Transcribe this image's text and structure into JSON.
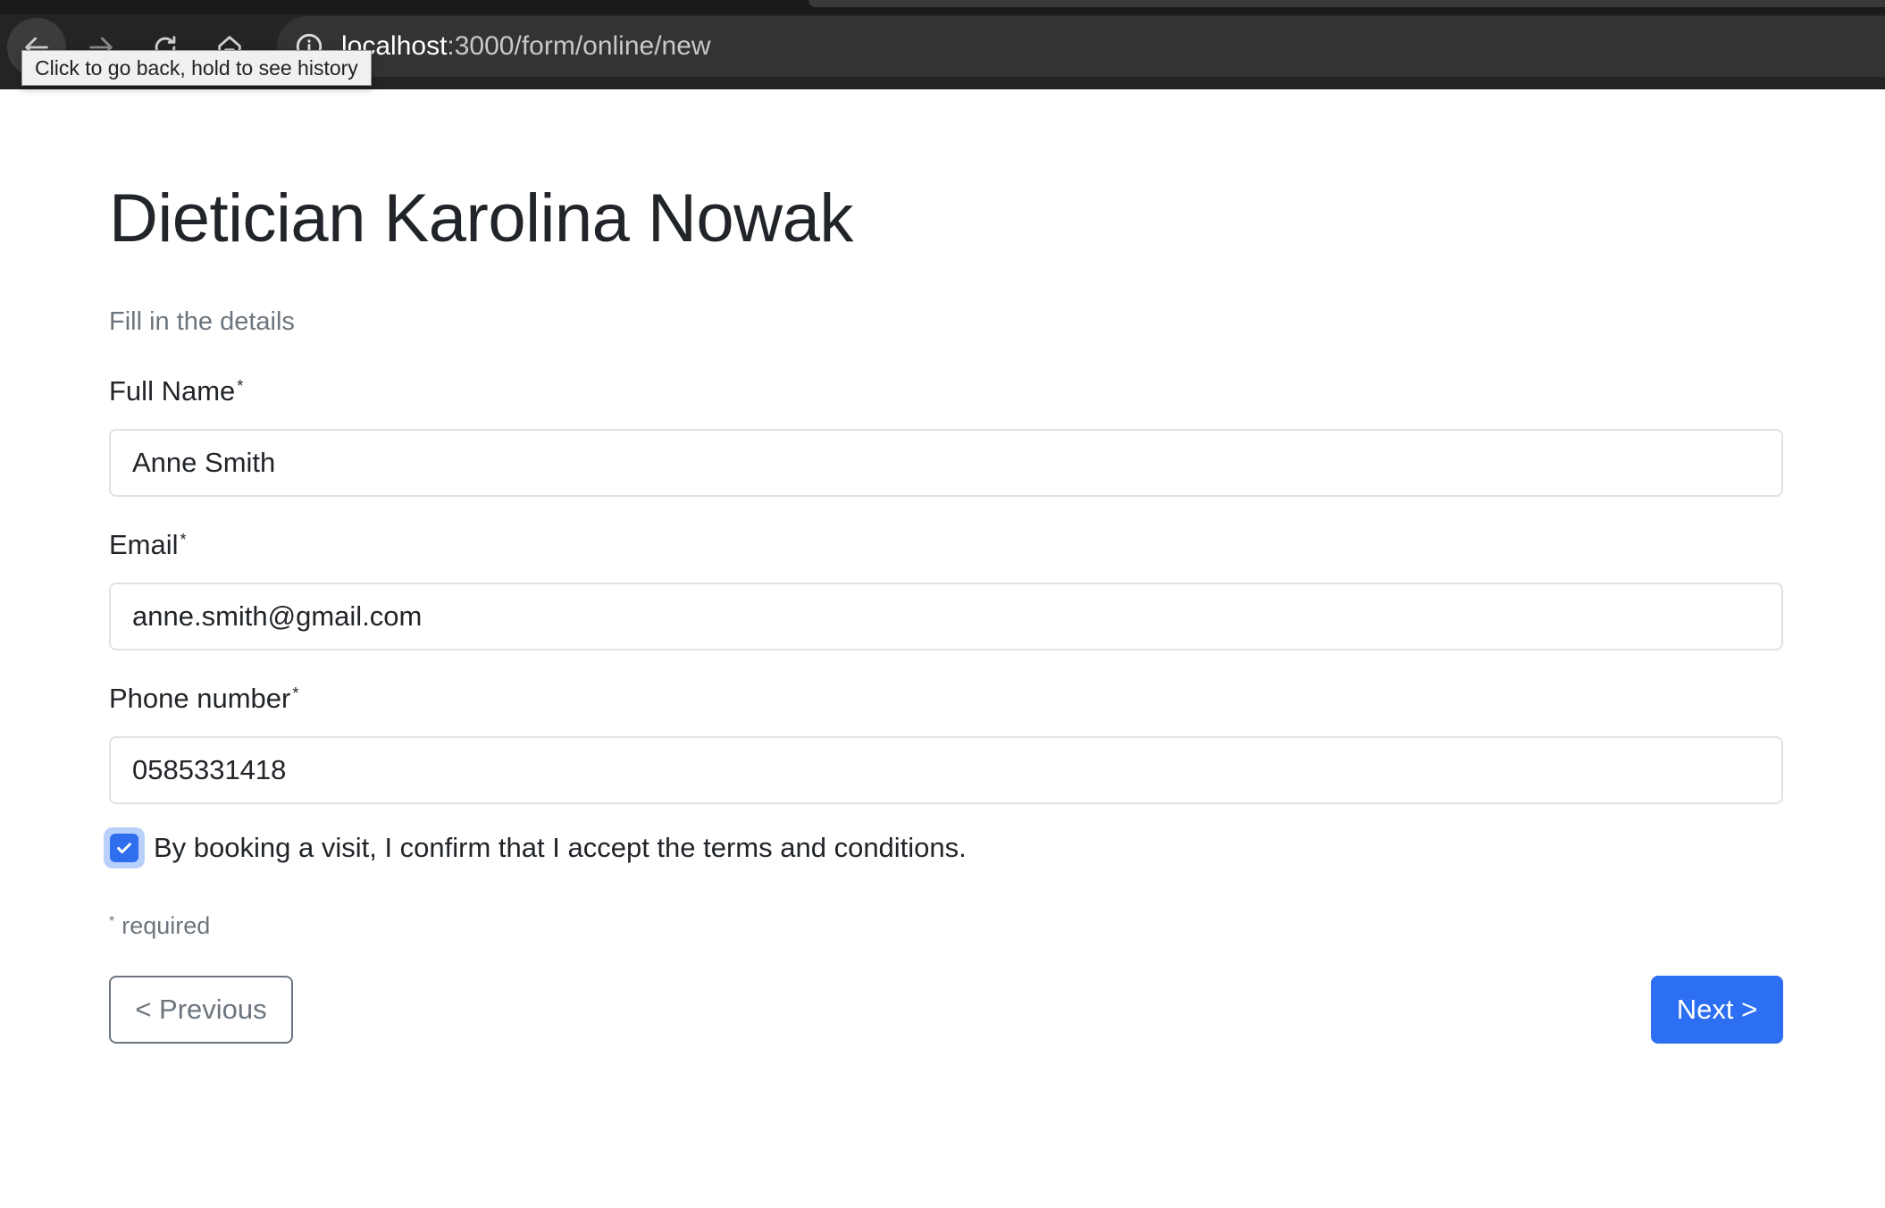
{
  "browser": {
    "url_host": "localhost",
    "url_path": ":3000/form/online/new",
    "back_tooltip": "Click to go back, hold to see history",
    "icons": [
      "back-arrow-icon",
      "forward-arrow-icon",
      "reload-icon",
      "home-icon",
      "info-icon"
    ]
  },
  "page": {
    "title": "Dietician Karolina Nowak",
    "subtitle": "Fill in the details"
  },
  "form": {
    "full_name": {
      "label": "Full Name",
      "required_mark": "*",
      "value": "Anne Smith"
    },
    "email": {
      "label": "Email",
      "required_mark": "*",
      "value": "anne.smith@gmail.com"
    },
    "phone": {
      "label": "Phone number",
      "required_mark": "*",
      "value": "0585331418"
    },
    "terms": {
      "label": "By booking a visit, I confirm that I accept the terms and conditions.",
      "checked": true
    },
    "required_note": {
      "mark": "*",
      "text": "required"
    },
    "previous_label": "< Previous",
    "next_label": "Next >"
  },
  "colors": {
    "primary": "#2d6ff2",
    "secondary": "#6c757d",
    "chrome_bg": "#242424"
  }
}
